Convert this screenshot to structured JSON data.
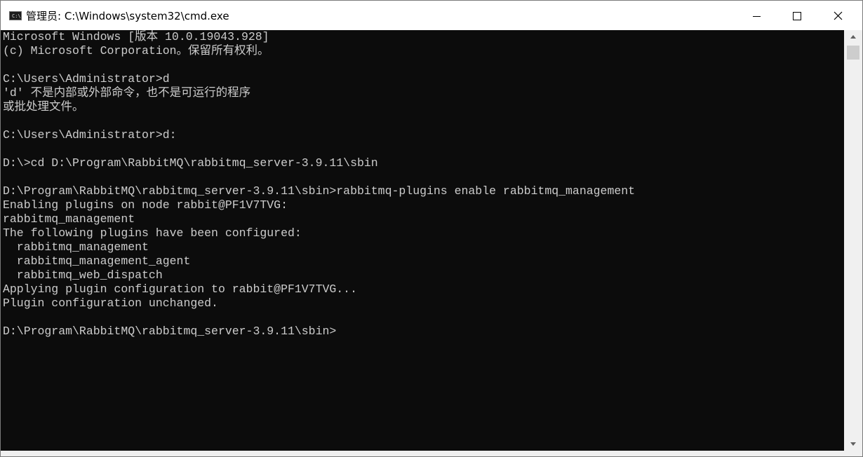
{
  "window": {
    "title": "管理员: C:\\Windows\\system32\\cmd.exe",
    "icon": "cmd-icon",
    "icon_glyph": "C:\\",
    "controls": {
      "minimize": "minimize-icon",
      "maximize": "maximize-icon",
      "close": "close-icon"
    }
  },
  "console": {
    "text_color": "#cccccc",
    "background": "#0c0c0c",
    "lines": [
      "Microsoft Windows [版本 10.0.19043.928]",
      "(c) Microsoft Corporation。保留所有权利。",
      "",
      "C:\\Users\\Administrator>d",
      "'d' 不是内部或外部命令，也不是可运行的程序",
      "或批处理文件。",
      "",
      "C:\\Users\\Administrator>d:",
      "",
      "D:\\>cd D:\\Program\\RabbitMQ\\rabbitmq_server-3.9.11\\sbin",
      "",
      "D:\\Program\\RabbitMQ\\rabbitmq_server-3.9.11\\sbin>rabbitmq-plugins enable rabbitmq_management",
      "Enabling plugins on node rabbit@PF1V7TVG:",
      "rabbitmq_management",
      "The following plugins have been configured:",
      "  rabbitmq_management",
      "  rabbitmq_management_agent",
      "  rabbitmq_web_dispatch",
      "Applying plugin configuration to rabbit@PF1V7TVG...",
      "Plugin configuration unchanged.",
      "",
      "D:\\Program\\RabbitMQ\\rabbitmq_server-3.9.11\\sbin>"
    ]
  },
  "scrollbar": {
    "up_icon": "scroll-up-arrow-icon",
    "down_icon": "scroll-down-arrow-icon"
  }
}
